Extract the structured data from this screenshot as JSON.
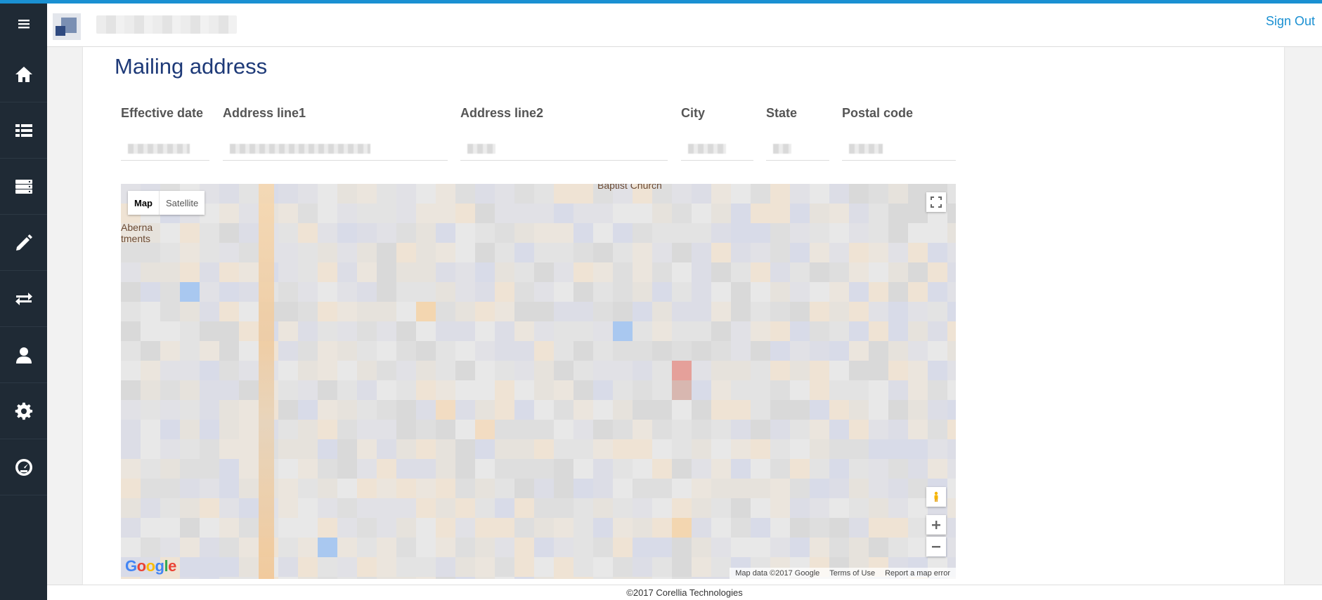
{
  "header": {
    "signout_label": "Sign Out"
  },
  "sidebar": {
    "items": [
      {
        "name": "home",
        "icon": "home-icon"
      },
      {
        "name": "list",
        "icon": "list-icon"
      },
      {
        "name": "server",
        "icon": "server-icon"
      },
      {
        "name": "edit",
        "icon": "pencil-icon"
      },
      {
        "name": "transfer",
        "icon": "transfer-icon"
      },
      {
        "name": "profile",
        "icon": "user-icon"
      },
      {
        "name": "settings",
        "icon": "gear-icon"
      },
      {
        "name": "dashboard",
        "icon": "gauge-icon"
      }
    ]
  },
  "section": {
    "title": "Mailing address",
    "fields": {
      "effective_date": "Effective date",
      "address_line1": "Address line1",
      "address_line2": "Address line2",
      "city": "City",
      "state": "State",
      "postal_code": "Postal code"
    }
  },
  "map": {
    "map_label": "Map",
    "satellite_label": "Satellite",
    "attribution": "Map data ©2017 Google",
    "terms": "Terms of Use",
    "report": "Report a map error",
    "place_labels": [
      "Baptist Church",
      "Aberna",
      "tments"
    ]
  },
  "footer": {
    "copyright": "©2017 Corellia Technologies"
  },
  "colors": {
    "accent": "#1a90d2",
    "sidebar": "#1f2a35",
    "title": "#1e3a78"
  }
}
